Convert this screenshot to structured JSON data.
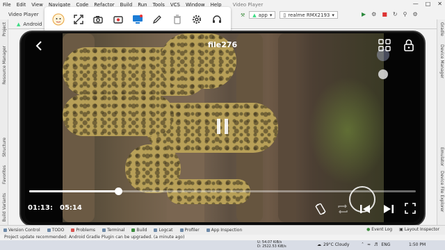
{
  "ide": {
    "menu": [
      "File",
      "Edit",
      "View",
      "Navigate",
      "Code",
      "Refactor",
      "Build",
      "Run",
      "Tools",
      "VCS",
      "Window",
      "Help"
    ],
    "window_title": "Video Player",
    "breadcrumb": "Video Player",
    "project_view": "Android",
    "run_config": "app",
    "device": "realme RMX2193",
    "left_tabs": [
      "Project",
      "Resource Manager",
      "Structure",
      "Favorites",
      "Build Variants"
    ],
    "right_tabs": [
      "Gradle",
      "Device Manager",
      "Emulator",
      "Device File Explorer"
    ],
    "bottom_tabs": [
      "Version Control",
      "TODO",
      "Problems",
      "Terminal",
      "Build",
      "Logcat",
      "Profiler",
      "App Inspection"
    ],
    "bottom_right": [
      "Event Log",
      "Layout Inspector"
    ],
    "status_message": "Project update recommended: Android Gradle Plugin can be upgraded. (a minute ago)"
  },
  "emulator_toolbar": {
    "icons": [
      "avatar-icon",
      "expand-icon",
      "camera-icon",
      "record-icon",
      "screen-mirror-icon",
      "pen-icon",
      "delete-icon",
      "settings-icon",
      "headset-icon"
    ]
  },
  "player": {
    "title": "file276",
    "current_time": "01:13",
    "separator": ":",
    "total_time": "05:14",
    "progress": 0.23,
    "colors": {
      "accent": "#ffffff",
      "track": "#888888"
    }
  },
  "taskbar": {
    "net_upload": "U: 54.07 KiB/s",
    "net_download": "D: 2522.53 KiB/s",
    "weather": "29°C  Cloudy",
    "language": "ENG",
    "clock": "1:50 PM"
  }
}
